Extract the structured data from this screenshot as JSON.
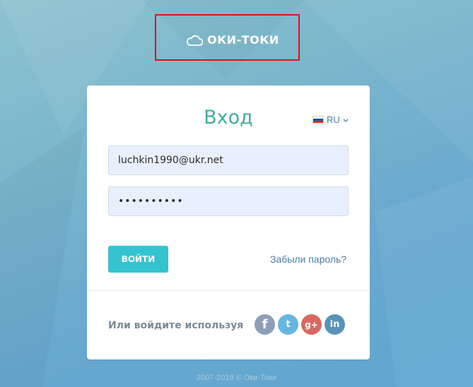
{
  "brand": {
    "name": "ОКИ-ТОКИ",
    "icon": "cloud-icon"
  },
  "colors": {
    "title": "#3fae9c",
    "login_button": "#35c3d0",
    "link": "#4a7ea0",
    "highlight_box": "#e0101a"
  },
  "login": {
    "title": "Вход",
    "language": "RU",
    "email_value": "luchkin1990@ukr.net",
    "password_value": "••••••••••",
    "submit_label": "ВОЙТИ",
    "forgot_label": "Забыли пароль?"
  },
  "social": {
    "label": "Или войдите используя",
    "facebook_glyph": "f",
    "twitter_glyph": "t",
    "google_glyph": "g+",
    "linkedin_glyph": "in"
  },
  "footer": {
    "text": "2007-2019 © Оки-Токи"
  }
}
